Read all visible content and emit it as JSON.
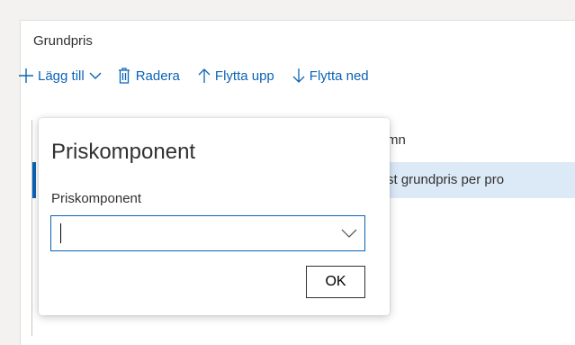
{
  "panel": {
    "title": "Grundpris"
  },
  "toolbar": {
    "add_label": "Lägg till",
    "delete_label": "Radera",
    "move_up_label": "Flytta upp",
    "move_down_label": "Flytta ned"
  },
  "grid": {
    "column_header_fragment": "mn",
    "row_text_fragment": "st grundpris per pro"
  },
  "dialog": {
    "title": "Priskomponent",
    "field_label": "Priskomponent",
    "field_value": "",
    "ok_label": "OK"
  },
  "colors": {
    "accent": "#0b63b6",
    "selected_row": "#dce9f7"
  }
}
